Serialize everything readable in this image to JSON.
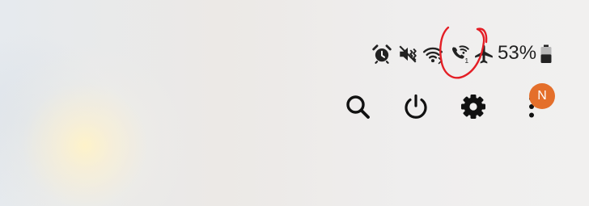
{
  "status_bar": {
    "icons": [
      {
        "name": "alarm-icon"
      },
      {
        "name": "vibrate-icon"
      },
      {
        "name": "wifi-icon"
      },
      {
        "name": "wifi-calling-icon",
        "sim_label": "1"
      },
      {
        "name": "airplane-mode-icon"
      }
    ],
    "battery_percent": "53%",
    "battery_level": 0.53
  },
  "annotation": {
    "color": "#e41e25",
    "target": "wifi-calling-icon"
  },
  "quick_panel": {
    "buttons": [
      {
        "name": "search-icon"
      },
      {
        "name": "power-icon"
      },
      {
        "name": "settings-icon"
      },
      {
        "name": "more-options-icon"
      }
    ],
    "badge_text": "N",
    "badge_color": "#e46f2b"
  }
}
